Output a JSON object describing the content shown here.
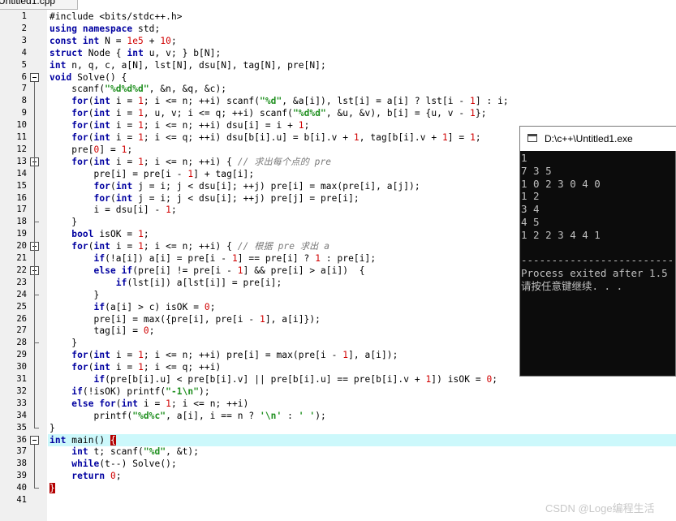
{
  "tab": {
    "title": "Untitled1.cpp"
  },
  "editor": {
    "lines": [
      {
        "n": "1",
        "code": [
          [
            "p",
            "#include <bits/stdc++.h>"
          ]
        ]
      },
      {
        "n": "2",
        "code": [
          [
            "k",
            "using namespace"
          ],
          [
            "p",
            " std;"
          ]
        ]
      },
      {
        "n": "3",
        "code": [
          [
            "k",
            "const int"
          ],
          [
            "p",
            " N = "
          ],
          [
            "n",
            "1e5"
          ],
          [
            "p",
            " + "
          ],
          [
            "n",
            "10"
          ],
          [
            "p",
            ";"
          ]
        ]
      },
      {
        "n": "4",
        "code": [
          [
            "k",
            "struct"
          ],
          [
            "p",
            " Node { "
          ],
          [
            "k",
            "int"
          ],
          [
            "p",
            " u, v; } b[N];"
          ]
        ]
      },
      {
        "n": "5",
        "code": [
          [
            "k",
            "int"
          ],
          [
            "p",
            " n, q, c, a[N], lst[N], dsu[N], tag[N], pre[N];"
          ]
        ]
      },
      {
        "n": "6",
        "code": [
          [
            "k",
            "void"
          ],
          [
            "p",
            " Solve() {"
          ]
        ]
      },
      {
        "n": "7",
        "code": [
          [
            "p",
            "    scanf("
          ],
          [
            "s",
            "\"%d%d%d\""
          ],
          [
            "p",
            ", &n, &q, &c);"
          ]
        ]
      },
      {
        "n": "8",
        "code": [
          [
            "p",
            "    "
          ],
          [
            "k",
            "for"
          ],
          [
            "p",
            "("
          ],
          [
            "k",
            "int"
          ],
          [
            "p",
            " i = "
          ],
          [
            "n",
            "1"
          ],
          [
            "p",
            "; i <= n; ++i) scanf("
          ],
          [
            "s",
            "\"%d\""
          ],
          [
            "p",
            ", &a[i]), lst[i] = a[i] ? lst[i - "
          ],
          [
            "n",
            "1"
          ],
          [
            "p",
            "] : i;"
          ]
        ]
      },
      {
        "n": "9",
        "code": [
          [
            "p",
            "    "
          ],
          [
            "k",
            "for"
          ],
          [
            "p",
            "("
          ],
          [
            "k",
            "int"
          ],
          [
            "p",
            " i = "
          ],
          [
            "n",
            "1"
          ],
          [
            "p",
            ", u, v; i <= q; ++i) scanf("
          ],
          [
            "s",
            "\"%d%d\""
          ],
          [
            "p",
            ", &u, &v), b[i] = {u, v - "
          ],
          [
            "n",
            "1"
          ],
          [
            "p",
            "};"
          ]
        ]
      },
      {
        "n": "10",
        "code": [
          [
            "p",
            "    "
          ],
          [
            "k",
            "for"
          ],
          [
            "p",
            "("
          ],
          [
            "k",
            "int"
          ],
          [
            "p",
            " i = "
          ],
          [
            "n",
            "1"
          ],
          [
            "p",
            "; i <= n; ++i) dsu[i] = i + "
          ],
          [
            "n",
            "1"
          ],
          [
            "p",
            ";"
          ]
        ]
      },
      {
        "n": "11",
        "code": [
          [
            "p",
            "    "
          ],
          [
            "k",
            "for"
          ],
          [
            "p",
            "("
          ],
          [
            "k",
            "int"
          ],
          [
            "p",
            " i = "
          ],
          [
            "n",
            "1"
          ],
          [
            "p",
            "; i <= q; ++i) dsu[b[i].u] = b[i].v + "
          ],
          [
            "n",
            "1"
          ],
          [
            "p",
            ", tag[b[i].v + "
          ],
          [
            "n",
            "1"
          ],
          [
            "p",
            "] = "
          ],
          [
            "n",
            "1"
          ],
          [
            "p",
            ";"
          ]
        ]
      },
      {
        "n": "12",
        "code": [
          [
            "p",
            "    pre["
          ],
          [
            "n",
            "0"
          ],
          [
            "p",
            "] = "
          ],
          [
            "n",
            "1"
          ],
          [
            "p",
            ";"
          ]
        ]
      },
      {
        "n": "13",
        "code": [
          [
            "p",
            "    "
          ],
          [
            "k",
            "for"
          ],
          [
            "p",
            "("
          ],
          [
            "k",
            "int"
          ],
          [
            "p",
            " i = "
          ],
          [
            "n",
            "1"
          ],
          [
            "p",
            "; i <= n; ++i) { "
          ],
          [
            "c",
            "// 求出每个点的 pre"
          ]
        ]
      },
      {
        "n": "14",
        "code": [
          [
            "p",
            "        pre[i] = pre[i - "
          ],
          [
            "n",
            "1"
          ],
          [
            "p",
            "] + tag[i];"
          ]
        ]
      },
      {
        "n": "15",
        "code": [
          [
            "p",
            "        "
          ],
          [
            "k",
            "for"
          ],
          [
            "p",
            "("
          ],
          [
            "k",
            "int"
          ],
          [
            "p",
            " j = i; j < dsu[i]; ++j) pre[i] = max(pre[i], a[j]);"
          ]
        ]
      },
      {
        "n": "16",
        "code": [
          [
            "p",
            "        "
          ],
          [
            "k",
            "for"
          ],
          [
            "p",
            "("
          ],
          [
            "k",
            "int"
          ],
          [
            "p",
            " j = i; j < dsu[i]; ++j) pre[j] = pre[i];"
          ]
        ]
      },
      {
        "n": "17",
        "code": [
          [
            "p",
            "        i = dsu[i] - "
          ],
          [
            "n",
            "1"
          ],
          [
            "p",
            ";"
          ]
        ]
      },
      {
        "n": "18",
        "code": [
          [
            "p",
            "    }"
          ]
        ]
      },
      {
        "n": "19",
        "code": [
          [
            "p",
            "    "
          ],
          [
            "k",
            "bool"
          ],
          [
            "p",
            " isOK = "
          ],
          [
            "n",
            "1"
          ],
          [
            "p",
            ";"
          ]
        ]
      },
      {
        "n": "20",
        "code": [
          [
            "p",
            "    "
          ],
          [
            "k",
            "for"
          ],
          [
            "p",
            "("
          ],
          [
            "k",
            "int"
          ],
          [
            "p",
            " i = "
          ],
          [
            "n",
            "1"
          ],
          [
            "p",
            "; i <= n; ++i) { "
          ],
          [
            "c",
            "// 根据 pre 求出 a"
          ]
        ]
      },
      {
        "n": "21",
        "code": [
          [
            "p",
            "        "
          ],
          [
            "k",
            "if"
          ],
          [
            "p",
            "(!a[i]) a[i] = pre[i - "
          ],
          [
            "n",
            "1"
          ],
          [
            "p",
            "] == pre[i] ? "
          ],
          [
            "n",
            "1"
          ],
          [
            "p",
            " : pre[i];"
          ]
        ]
      },
      {
        "n": "22",
        "code": [
          [
            "p",
            "        "
          ],
          [
            "k",
            "else if"
          ],
          [
            "p",
            "(pre[i] != pre[i - "
          ],
          [
            "n",
            "1"
          ],
          [
            "p",
            "] && pre[i] > a[i])  {"
          ]
        ]
      },
      {
        "n": "23",
        "code": [
          [
            "p",
            "            "
          ],
          [
            "k",
            "if"
          ],
          [
            "p",
            "(lst[i]) a[lst[i]] = pre[i];"
          ]
        ]
      },
      {
        "n": "24",
        "code": [
          [
            "p",
            "        }"
          ]
        ]
      },
      {
        "n": "25",
        "code": [
          [
            "p",
            "        "
          ],
          [
            "k",
            "if"
          ],
          [
            "p",
            "(a[i] > c) isOK = "
          ],
          [
            "n",
            "0"
          ],
          [
            "p",
            ";"
          ]
        ]
      },
      {
        "n": "26",
        "code": [
          [
            "p",
            "        pre[i] = max({pre[i], pre[i - "
          ],
          [
            "n",
            "1"
          ],
          [
            "p",
            "], a[i]});"
          ]
        ]
      },
      {
        "n": "27",
        "code": [
          [
            "p",
            "        tag[i] = "
          ],
          [
            "n",
            "0"
          ],
          [
            "p",
            ";"
          ]
        ]
      },
      {
        "n": "28",
        "code": [
          [
            "p",
            "    }"
          ]
        ]
      },
      {
        "n": "29",
        "code": [
          [
            "p",
            "    "
          ],
          [
            "k",
            "for"
          ],
          [
            "p",
            "("
          ],
          [
            "k",
            "int"
          ],
          [
            "p",
            " i = "
          ],
          [
            "n",
            "1"
          ],
          [
            "p",
            "; i <= n; ++i) pre[i] = max(pre[i - "
          ],
          [
            "n",
            "1"
          ],
          [
            "p",
            "], a[i]);"
          ]
        ]
      },
      {
        "n": "30",
        "code": [
          [
            "p",
            "    "
          ],
          [
            "k",
            "for"
          ],
          [
            "p",
            "("
          ],
          [
            "k",
            "int"
          ],
          [
            "p",
            " i = "
          ],
          [
            "n",
            "1"
          ],
          [
            "p",
            "; i <= q; ++i)"
          ]
        ]
      },
      {
        "n": "31",
        "code": [
          [
            "p",
            "        "
          ],
          [
            "k",
            "if"
          ],
          [
            "p",
            "(pre[b[i].u] < pre[b[i].v] || pre[b[i].u] == pre[b[i].v + "
          ],
          [
            "n",
            "1"
          ],
          [
            "p",
            "]) isOK = "
          ],
          [
            "n",
            "0"
          ],
          [
            "p",
            ";"
          ]
        ]
      },
      {
        "n": "32",
        "code": [
          [
            "p",
            "    "
          ],
          [
            "k",
            "if"
          ],
          [
            "p",
            "(!isOK) printf("
          ],
          [
            "s",
            "\"-1\\n\""
          ],
          [
            "p",
            ");"
          ]
        ]
      },
      {
        "n": "33",
        "code": [
          [
            "p",
            "    "
          ],
          [
            "k",
            "else for"
          ],
          [
            "p",
            "("
          ],
          [
            "k",
            "int"
          ],
          [
            "p",
            " i = "
          ],
          [
            "n",
            "1"
          ],
          [
            "p",
            "; i <= n; ++i)"
          ]
        ]
      },
      {
        "n": "34",
        "code": [
          [
            "p",
            "        printf("
          ],
          [
            "s",
            "\"%d%c\""
          ],
          [
            "p",
            ", a[i], i == n ? "
          ],
          [
            "s",
            "'\\n'"
          ],
          [
            "p",
            " : "
          ],
          [
            "s",
            "' '"
          ],
          [
            "p",
            ");"
          ]
        ]
      },
      {
        "n": "35",
        "code": [
          [
            "p",
            "}"
          ]
        ]
      },
      {
        "n": "36",
        "code": [
          [
            "k",
            "int"
          ],
          [
            "p",
            " main() "
          ],
          [
            "hl",
            "{"
          ]
        ]
      },
      {
        "n": "37",
        "code": [
          [
            "p",
            "    "
          ],
          [
            "k",
            "int"
          ],
          [
            "p",
            " t; scanf("
          ],
          [
            "s",
            "\"%d\""
          ],
          [
            "p",
            ", &t);"
          ]
        ]
      },
      {
        "n": "38",
        "code": [
          [
            "p",
            "    "
          ],
          [
            "k",
            "while"
          ],
          [
            "p",
            "(t--) Solve();"
          ]
        ]
      },
      {
        "n": "39",
        "code": [
          [
            "p",
            "    "
          ],
          [
            "k",
            "return"
          ],
          [
            "p",
            " "
          ],
          [
            "n",
            "0"
          ],
          [
            "p",
            ";"
          ]
        ]
      },
      {
        "n": "40",
        "code": [
          [
            "hl",
            "}"
          ]
        ]
      },
      {
        "n": "41",
        "code": []
      }
    ]
  },
  "console": {
    "title": "D:\\c++\\Untitled1.exe",
    "lines": [
      "1",
      "7 3 5",
      "1 0 2 3 0 4 0",
      "1 2",
      "3 4",
      "4 5",
      "1 2 2 3 4 4 1",
      "",
      "--------------------------------",
      "Process exited after 1.5",
      "请按任意键继续. . ."
    ]
  },
  "watermark": {
    "text": "CSDN @Loge编程生活"
  }
}
